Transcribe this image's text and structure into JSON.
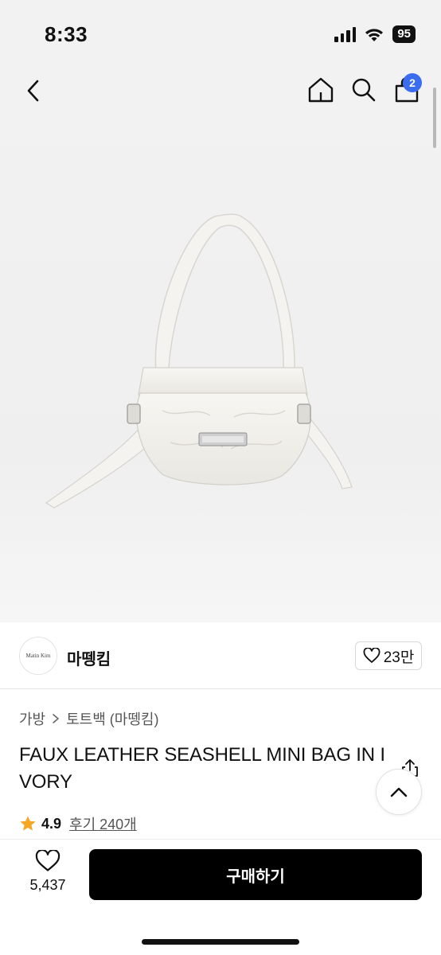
{
  "status_bar": {
    "time": "8:33",
    "battery": "95"
  },
  "nav": {
    "cart_count": "2"
  },
  "seller": {
    "logo_text": "Matin Kim",
    "name": "마뗑킴",
    "likes": "23만"
  },
  "breadcrumb": {
    "category": "가방",
    "subcategory": "토트백 (마뗑킴)"
  },
  "product": {
    "title": "FAUX LEATHER SEASHELL MINI BAG IN IVORY",
    "rating": "4.9",
    "reviews": "후기 240개"
  },
  "bottom_bar": {
    "wish_count": "5,437",
    "buy_label": "구매하기"
  },
  "colors": {
    "accent": "#3a6df0",
    "star": "#f5a623",
    "buy_button": "#000000"
  },
  "icons": [
    "back-arrow-icon",
    "home-icon",
    "search-icon",
    "shopping-bag-icon",
    "heart-icon",
    "share-icon",
    "chevron-up-icon",
    "star-icon"
  ]
}
